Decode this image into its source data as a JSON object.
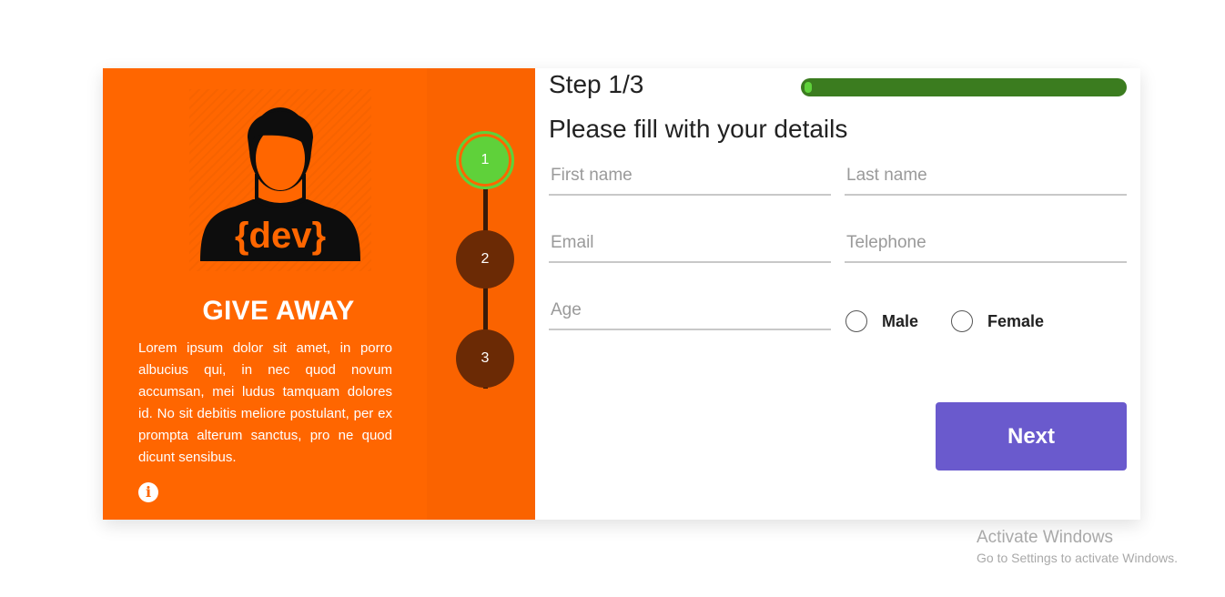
{
  "promo": {
    "title": "GIVE AWAY",
    "avatar_shirt_text": "{dev}",
    "description": "Lorem ipsum dolor sit amet, in porro albucius qui, in nec quod novum accumsan, mei ludus tamquam dolores id. No sit debitis meliore postulant, per ex prompta alterum sanctus, pro ne quod dicunt sensibus.",
    "info_icon": "info-circle-icon"
  },
  "steps": [
    {
      "number": "1",
      "active": true
    },
    {
      "number": "2",
      "active": false
    },
    {
      "number": "3",
      "active": false
    }
  ],
  "form": {
    "step_label": "Step 1/3",
    "progress": 0.02,
    "title": "Please fill with your details",
    "fields": {
      "first_name": {
        "placeholder": "First name",
        "value": ""
      },
      "last_name": {
        "placeholder": "Last name",
        "value": ""
      },
      "email": {
        "placeholder": "Email",
        "value": ""
      },
      "telephone": {
        "placeholder": "Telephone",
        "value": ""
      },
      "age": {
        "placeholder": "Age",
        "value": ""
      }
    },
    "gender": {
      "male_label": "Male",
      "female_label": "Female",
      "selected": null
    },
    "next_label": "Next"
  },
  "watermark": {
    "title": "Activate Windows",
    "subtitle": "Go to Settings to activate Windows."
  },
  "colors": {
    "orange": "#ff6600",
    "step_active": "#5fd13a",
    "step_inactive": "#6b2a05",
    "progress_track": "#3b7c1f",
    "button": "#6a5acd"
  }
}
